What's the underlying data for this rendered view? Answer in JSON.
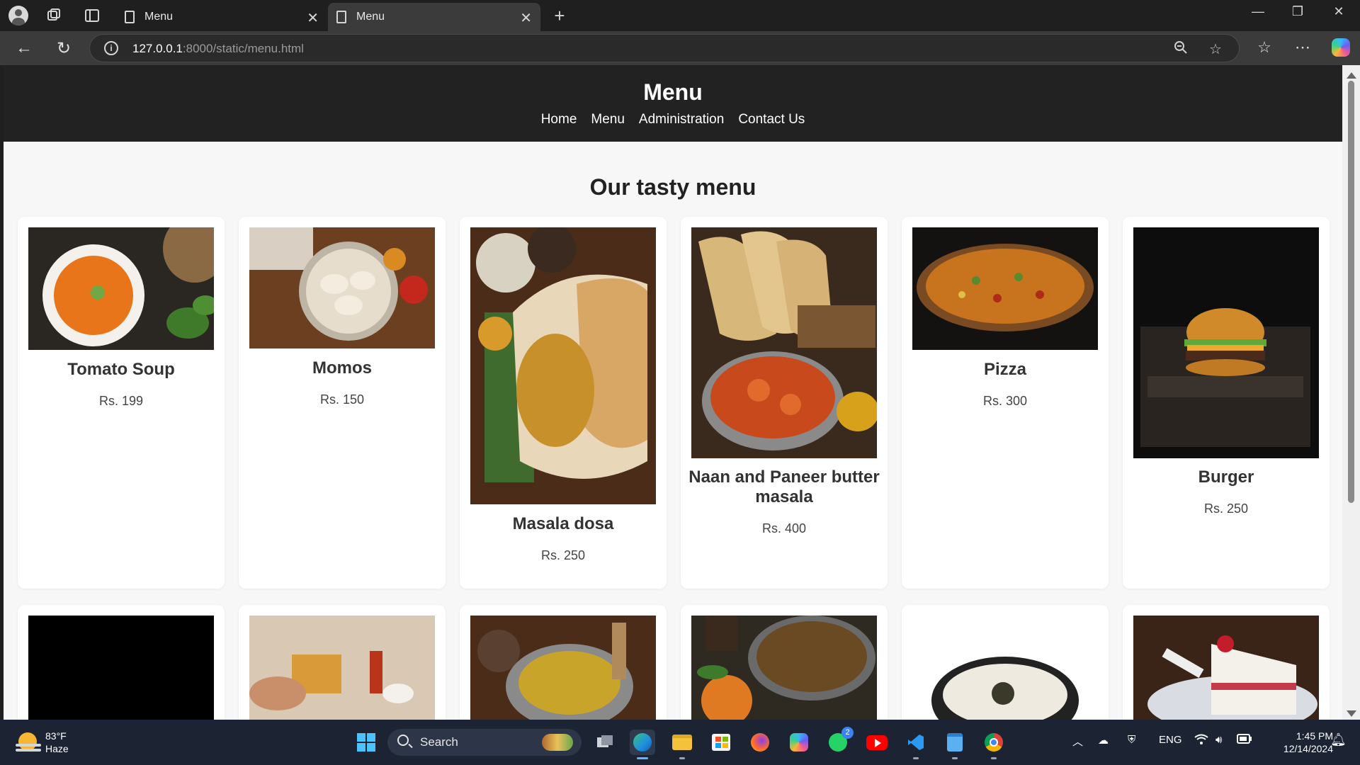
{
  "browser": {
    "tabs": [
      {
        "title": "Menu"
      },
      {
        "title": "Menu"
      }
    ],
    "url_host": "127.0.0.1",
    "url_rest": ":8000/static/menu.html"
  },
  "site": {
    "title": "Menu",
    "nav": [
      "Home",
      "Menu",
      "Administration",
      "Contact Us"
    ],
    "section_title": "Our tasty menu"
  },
  "menu_items": [
    {
      "name": "Tomato Soup",
      "price": "Rs. 199"
    },
    {
      "name": "Momos",
      "price": "Rs. 150"
    },
    {
      "name": "Masala dosa",
      "price": "Rs. 250"
    },
    {
      "name": "Naan and Paneer butter masala",
      "price": "Rs. 400"
    },
    {
      "name": "Pizza",
      "price": "Rs. 300"
    },
    {
      "name": "Burger",
      "price": "Rs. 250"
    }
  ],
  "taskbar": {
    "weather_temp": "83°F",
    "weather_desc": "Haze",
    "search_placeholder": "Search",
    "whatsapp_badge": "2",
    "language": "ENG",
    "time": "1:45 PM",
    "date": "12/14/2024"
  }
}
